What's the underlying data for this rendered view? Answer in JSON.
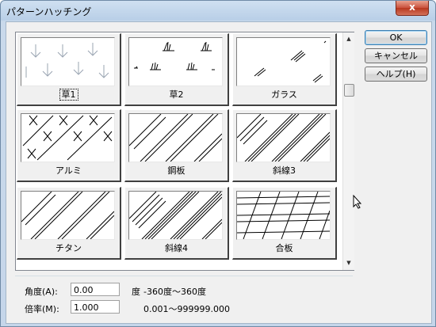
{
  "window": {
    "title": "パターンハッチング",
    "close_glyph": "x"
  },
  "patterns": [
    {
      "label": "草1",
      "icon": "grass1-pattern-icon"
    },
    {
      "label": "草2",
      "icon": "grass2-pattern-icon"
    },
    {
      "label": "ガラス",
      "icon": "glass-pattern-icon"
    },
    {
      "label": "アルミ",
      "icon": "aluminum-pattern-icon"
    },
    {
      "label": "鋼板",
      "icon": "steel-plate-pattern-icon"
    },
    {
      "label": "斜線3",
      "icon": "diagonal3-pattern-icon"
    },
    {
      "label": "チタン",
      "icon": "titanium-pattern-icon"
    },
    {
      "label": "斜線4",
      "icon": "diagonal4-pattern-icon"
    },
    {
      "label": "合板",
      "icon": "plywood-pattern-icon"
    }
  ],
  "selected_pattern": "草1",
  "buttons": {
    "ok": "OK",
    "cancel": "キャンセル",
    "help": "ヘルプ(H)"
  },
  "angle": {
    "label": "角度(A):",
    "value": "0.00",
    "unit": "度",
    "range": "-360度〜360度"
  },
  "scale": {
    "label": "倍率(M):",
    "value": "1.000",
    "range": "0.001〜999999.000"
  }
}
